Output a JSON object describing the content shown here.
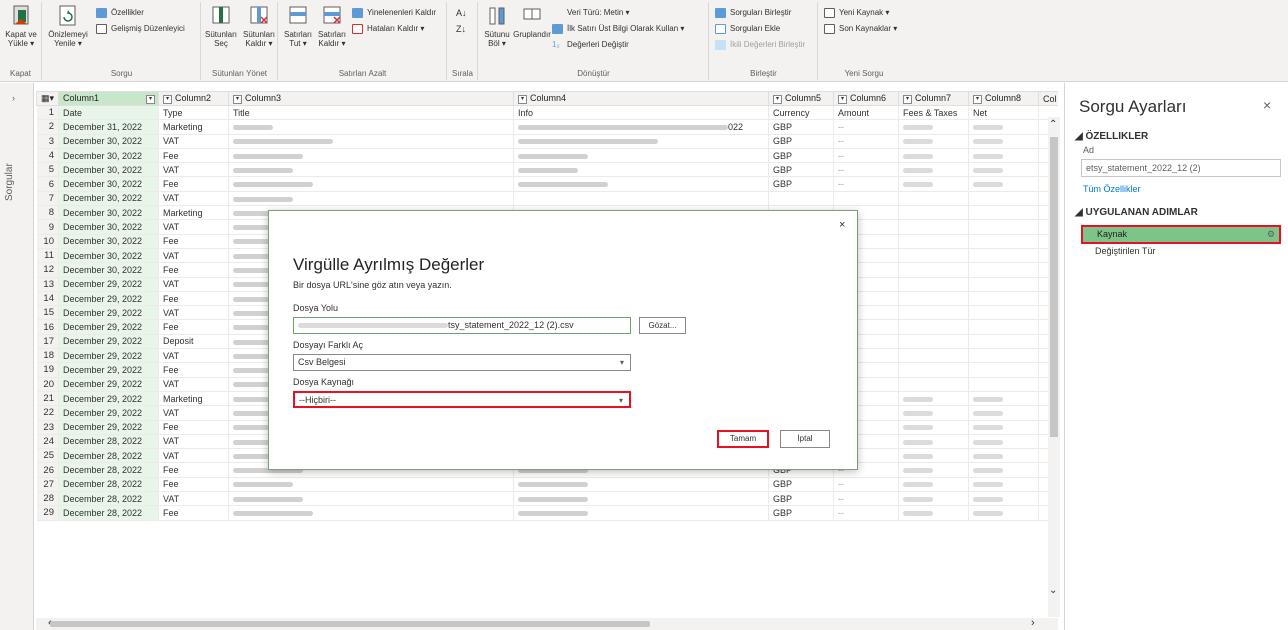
{
  "ribbon": {
    "groups": [
      {
        "name": "Kapat",
        "big": "Kapat ve Yükle ▾"
      },
      {
        "name": "Sorgu",
        "big": "Önizlemeyi Yenile ▾",
        "small": [
          "Özellikler",
          "Gelişmiş Düzenleyici"
        ]
      },
      {
        "name": "Sütunları Yönet",
        "big1": "Sütunları Seç",
        "big2": "Sütunları Kaldır ▾"
      },
      {
        "name": "Satırları Azalt",
        "big1": "Satırları Tut ▾",
        "big2": "Satırları Kaldır ▾",
        "small": [
          "Yinelenenleri Kaldır",
          "Hataları Kaldır ▾"
        ]
      },
      {
        "name": "Sırala"
      },
      {
        "name": "Dönüştür",
        "big1": "Sütunu Böl ▾",
        "big2": "Gruplandır",
        "small": [
          "Veri Türü: Metin ▾",
          "İlk Satırı Üst Bilgi Olarak Kullan ▾",
          "Değerleri Değiştir"
        ]
      },
      {
        "name": "Birleştir",
        "small": [
          "Sorguları Birleştir",
          "Sorguları Ekle",
          "İkili Değerleri Birleştir"
        ]
      },
      {
        "name": "Yeni Sorgu",
        "small": [
          "Yeni Kaynak ▾",
          "Son Kaynaklar ▾"
        ]
      }
    ]
  },
  "leftnav": {
    "label": "Sorgular",
    "arrow": "›"
  },
  "grid": {
    "headers": [
      "Column1",
      "Column2",
      "Column3",
      "Column4",
      "Column5",
      "Column6",
      "Column7",
      "Column8",
      "Col"
    ],
    "header_row": [
      "Date",
      "Type",
      "Title",
      "Info",
      "Currency",
      "Amount",
      "Fees & Taxes",
      "Net"
    ],
    "rows": [
      {
        "n": "2",
        "date": "December 31, 2022",
        "type": "Marketing",
        "cur": "GBP",
        "amt": "--",
        "info_tail": "022"
      },
      {
        "n": "3",
        "date": "December 30, 2022",
        "type": "VAT",
        "cur": "GBP",
        "amt": "--"
      },
      {
        "n": "4",
        "date": "December 30, 2022",
        "type": "Fee",
        "cur": "GBP",
        "amt": "--"
      },
      {
        "n": "5",
        "date": "December 30, 2022",
        "type": "VAT",
        "cur": "GBP",
        "amt": "--"
      },
      {
        "n": "6",
        "date": "December 30, 2022",
        "type": "Fee",
        "cur": "GBP",
        "amt": "--"
      },
      {
        "n": "7",
        "date": "December 30, 2022",
        "type": "VAT",
        "cur": "",
        "amt": ""
      },
      {
        "n": "8",
        "date": "December 30, 2022",
        "type": "Marketing",
        "cur": "",
        "amt": ""
      },
      {
        "n": "9",
        "date": "December 30, 2022",
        "type": "VAT",
        "cur": "",
        "amt": ""
      },
      {
        "n": "10",
        "date": "December 30, 2022",
        "type": "Fee",
        "cur": "",
        "amt": ""
      },
      {
        "n": "11",
        "date": "December 30, 2022",
        "type": "VAT",
        "cur": "",
        "amt": ""
      },
      {
        "n": "12",
        "date": "December 30, 2022",
        "type": "Fee",
        "cur": "",
        "amt": ""
      },
      {
        "n": "13",
        "date": "December 29, 2022",
        "type": "VAT",
        "cur": "",
        "amt": ""
      },
      {
        "n": "14",
        "date": "December 29, 2022",
        "type": "Fee",
        "cur": "",
        "amt": ""
      },
      {
        "n": "15",
        "date": "December 29, 2022",
        "type": "VAT",
        "cur": "",
        "amt": ""
      },
      {
        "n": "16",
        "date": "December 29, 2022",
        "type": "Fee",
        "cur": "",
        "amt": ""
      },
      {
        "n": "17",
        "date": "December 29, 2022",
        "type": "Deposit",
        "cur": "",
        "amt": ""
      },
      {
        "n": "18",
        "date": "December 29, 2022",
        "type": "VAT",
        "cur": "",
        "amt": ""
      },
      {
        "n": "19",
        "date": "December 29, 2022",
        "type": "Fee",
        "cur": "",
        "amt": ""
      },
      {
        "n": "20",
        "date": "December 29, 2022",
        "type": "VAT",
        "cur": "",
        "amt": ""
      },
      {
        "n": "21",
        "date": "December 29, 2022",
        "type": "Marketing",
        "cur": "GBP",
        "amt": ""
      },
      {
        "n": "22",
        "date": "December 29, 2022",
        "type": "VAT",
        "cur": "GBP",
        "amt": "--"
      },
      {
        "n": "23",
        "date": "December 29, 2022",
        "type": "Fee",
        "cur": "GBP",
        "amt": "--"
      },
      {
        "n": "24",
        "date": "December 28, 2022",
        "type": "VAT",
        "cur": "GBP",
        "amt": "--"
      },
      {
        "n": "25",
        "date": "December 28, 2022",
        "type": "VAT",
        "cur": "GBP",
        "amt": "--"
      },
      {
        "n": "26",
        "date": "December 28, 2022",
        "type": "Fee",
        "cur": "GBP",
        "amt": "--"
      },
      {
        "n": "27",
        "date": "December 28, 2022",
        "type": "Fee",
        "cur": "GBP",
        "amt": "--"
      },
      {
        "n": "28",
        "date": "December 28, 2022",
        "type": "VAT",
        "cur": "GBP",
        "amt": "--"
      },
      {
        "n": "29",
        "date": "December 28, 2022",
        "type": "Fee",
        "cur": "GBP",
        "amt": "--"
      }
    ]
  },
  "rpane": {
    "title": "Sorgu Ayarları",
    "close": "×",
    "props_header": "◢ ÖZELLIKLER",
    "name_label": "Ad",
    "name_value": "etsy_statement_2022_12 (2)",
    "all_props": "Tüm Özellikler",
    "steps_header": "◢ UYGULANAN ADIMLAR",
    "steps": [
      "Kaynak",
      "Değiştirilen Tür"
    ]
  },
  "dialog": {
    "title": "Virgülle Ayrılmış Değerler",
    "subtitle": "Bir dosya URL'sine göz atın veya yazın.",
    "path_label": "Dosya Yolu",
    "path_value": "tsy_statement_2022_12 (2).csv",
    "browse": "Gözat...",
    "open_as_label": "Dosyayı Farklı Aç",
    "open_as_value": "Csv Belgesi",
    "origin_label": "Dosya Kaynağı",
    "origin_value": "--Hiçbiri--",
    "ok": "Tamam",
    "cancel": "İptal",
    "close": "×"
  },
  "colors": {
    "accent_green": "#7cc487",
    "highlight_red": "#e81123",
    "link_blue": "#0078d4"
  }
}
